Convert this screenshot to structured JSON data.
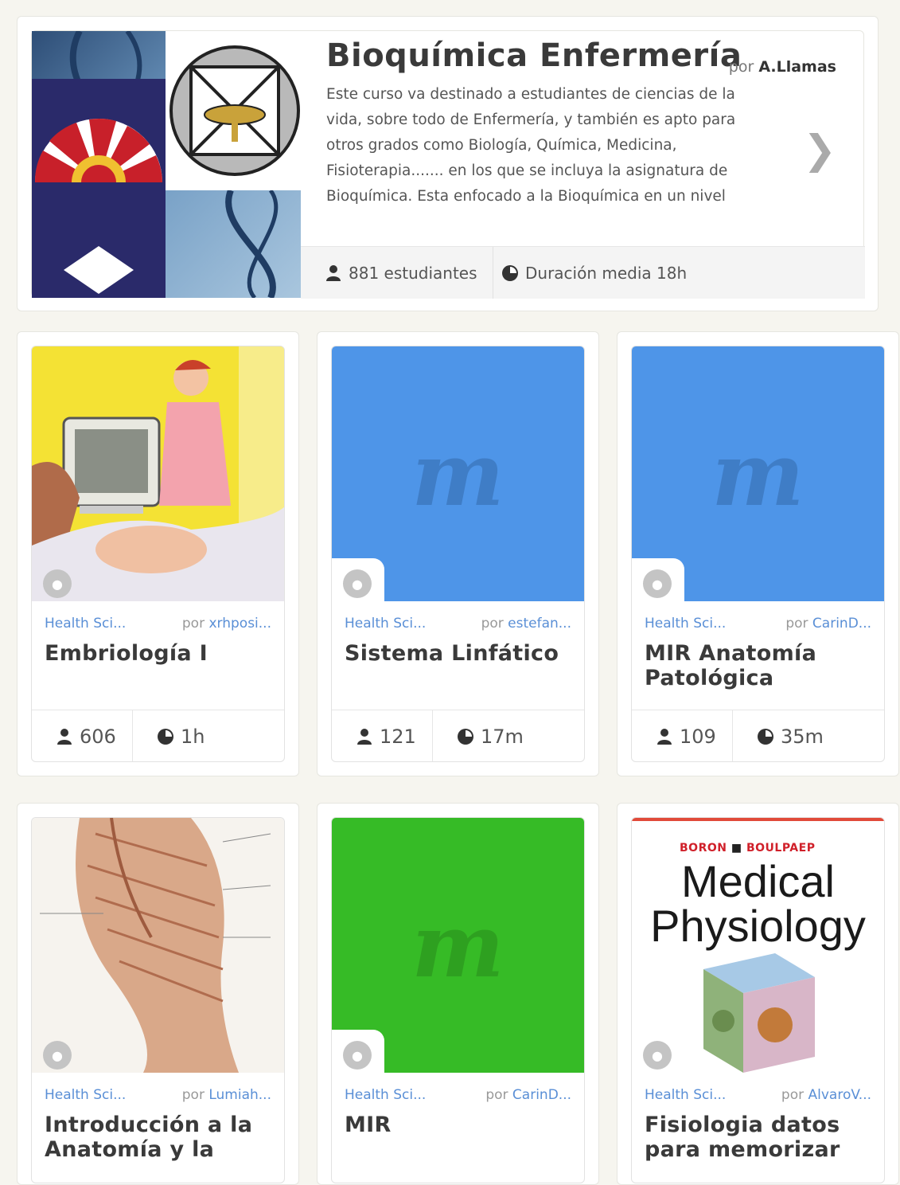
{
  "featured": {
    "title": "Bioquímica Enfermería",
    "by_prefix": "por",
    "author": "A.Llamas",
    "description": "Este curso va destinado a estudiantes de ciencias de la vida, sobre todo de Enfermería, y también es apto para otros grados como Biología, Química, Medicina, Fisioterapia....... en los que se incluya la asignatura de Bioquímica. Esta enfocado a la Bioquímica en un nivel",
    "students": "881 estudiantes",
    "duration": "Duración media 18h",
    "next_icon": "chevron-right-icon"
  },
  "courses": [
    {
      "category": "Health Sci...",
      "by_prefix": "por",
      "author": "xrhposi...",
      "title": "Embriología I",
      "students": "606",
      "duration": "1h"
    },
    {
      "category": "Health Sci...",
      "by_prefix": "por",
      "author": "estefan...",
      "title": "Sistema Linfático",
      "students": "121",
      "duration": "17m",
      "placeholder_color": "#4e95e8",
      "logo_color": "#3f7dc6"
    },
    {
      "category": "Health Sci...",
      "by_prefix": "por",
      "author": "CarinD...",
      "title": "MIR Anatomía Patológica",
      "students": "109",
      "duration": "35m",
      "placeholder_color": "#4e95e8",
      "logo_color": "#3f7dc6"
    },
    {
      "category": "Health Sci...",
      "by_prefix": "por",
      "author": "Lumiah...",
      "title": "Introducción a la Anatomía y la"
    },
    {
      "category": "Health Sci...",
      "by_prefix": "por",
      "author": "CarinD...",
      "title": "MIR",
      "placeholder_color": "#36bb26",
      "logo_color": "#2ea020"
    },
    {
      "category": "Health Sci...",
      "by_prefix": "por",
      "author": "AlvaroV...",
      "title": "Fisiologia datos para memorizar",
      "cover": {
        "authors_left": "BORON",
        "authors_right": "BOULPAEP",
        "line1": "Medical",
        "line2": "Physiology"
      }
    }
  ],
  "m_logo": "m",
  "icons": {
    "user": "user-icon",
    "clock": "clock-icon",
    "tag": "tag-icon"
  }
}
